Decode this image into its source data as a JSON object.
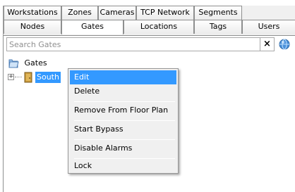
{
  "tabs_row1": [
    "Workstations",
    "Zones",
    "Cameras",
    "TCP Network",
    "Segments"
  ],
  "tabs_row2": [
    "Nodes",
    "Gates",
    "Locations",
    "Tags",
    "Users"
  ],
  "active_tab": "Gates",
  "search": {
    "placeholder": "Search Gates",
    "value": "",
    "clear_label": "×"
  },
  "tree": {
    "root_label": "Gates",
    "child_label": "South",
    "expander": "+"
  },
  "context_menu": {
    "items": [
      "Edit",
      "Delete",
      "Remove From Floor Plan",
      "Start Bypass",
      "Disable Alarms",
      "Lock"
    ],
    "highlighted": "Edit"
  },
  "colors": {
    "selection": "#3399ff",
    "tab_border": "#8e8f8f",
    "menu_bg": "#f0f0f0"
  }
}
